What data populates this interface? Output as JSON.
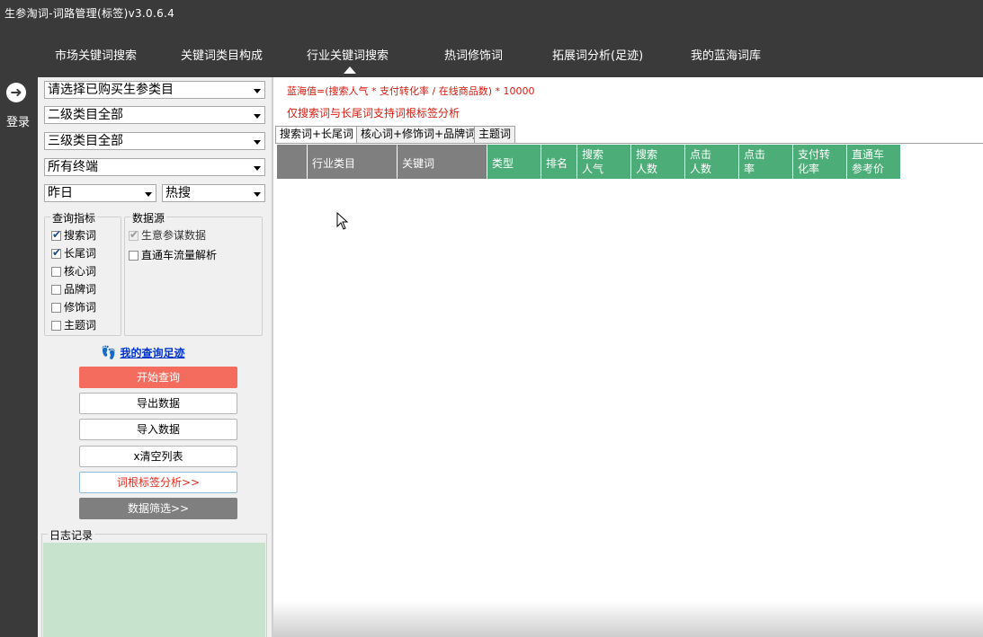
{
  "title": "生参淘词-词路管理(标签)v3.0.6.4",
  "nav": {
    "items": [
      "市场关键词搜索",
      "关键词类目构成",
      "行业关键词搜索",
      "热词修饰词",
      "拓展词分析(足迹)",
      "我的蓝海词库"
    ],
    "active_index": 2
  },
  "sidebar": {
    "login_label": "登录"
  },
  "filters": {
    "category": "请选择已购买生参类目",
    "level2": "二级类目全部",
    "level3": "三级类目全部",
    "terminal": "所有终端",
    "date": "昨日",
    "search_type": "热搜"
  },
  "query_metrics": {
    "title": "查询指标",
    "items": [
      {
        "label": "搜索词",
        "checked": true
      },
      {
        "label": "长尾词",
        "checked": true
      },
      {
        "label": "核心词",
        "checked": false
      },
      {
        "label": "品牌词",
        "checked": false
      },
      {
        "label": "修饰词",
        "checked": false
      },
      {
        "label": "主题词",
        "checked": false
      }
    ]
  },
  "data_source": {
    "title": "数据源",
    "items": [
      {
        "label": "生意参谋数据",
        "checked": true,
        "disabled": true
      },
      {
        "label": "直通车流量解析",
        "checked": false,
        "disabled": false
      }
    ]
  },
  "footprint_link": "我的查询足迹",
  "buttons": {
    "start": "开始查询",
    "export": "导出数据",
    "import": "导入数据",
    "clear": "x清空列表",
    "analysis": "词根标签分析>>",
    "filter": "数据筛选>>"
  },
  "log": {
    "title": "日志记录"
  },
  "main": {
    "formula": "蓝海值=(搜索人气 * 支付转化率 / 在线商品数) * 10000",
    "note": "仅搜索词与长尾词支持词根标签分析",
    "tabs": [
      "搜索词+长尾词",
      "核心词+修饰词+品牌词",
      "主题词"
    ],
    "active_tab": 0,
    "columns": [
      "",
      "行业类目",
      "关键词",
      "类型",
      "排名",
      "搜索\n人气",
      "搜索\n人数",
      "点击\n人数",
      "点击\n率",
      "支付转\n化率",
      "直通车\n参考价"
    ]
  },
  "colors": {
    "primary_button": "#f36c5d",
    "header_green": "#4cad78",
    "header_gray": "#7f7f7f",
    "accent_red": "#d41a0d",
    "log_bg": "#c7e3cd"
  }
}
